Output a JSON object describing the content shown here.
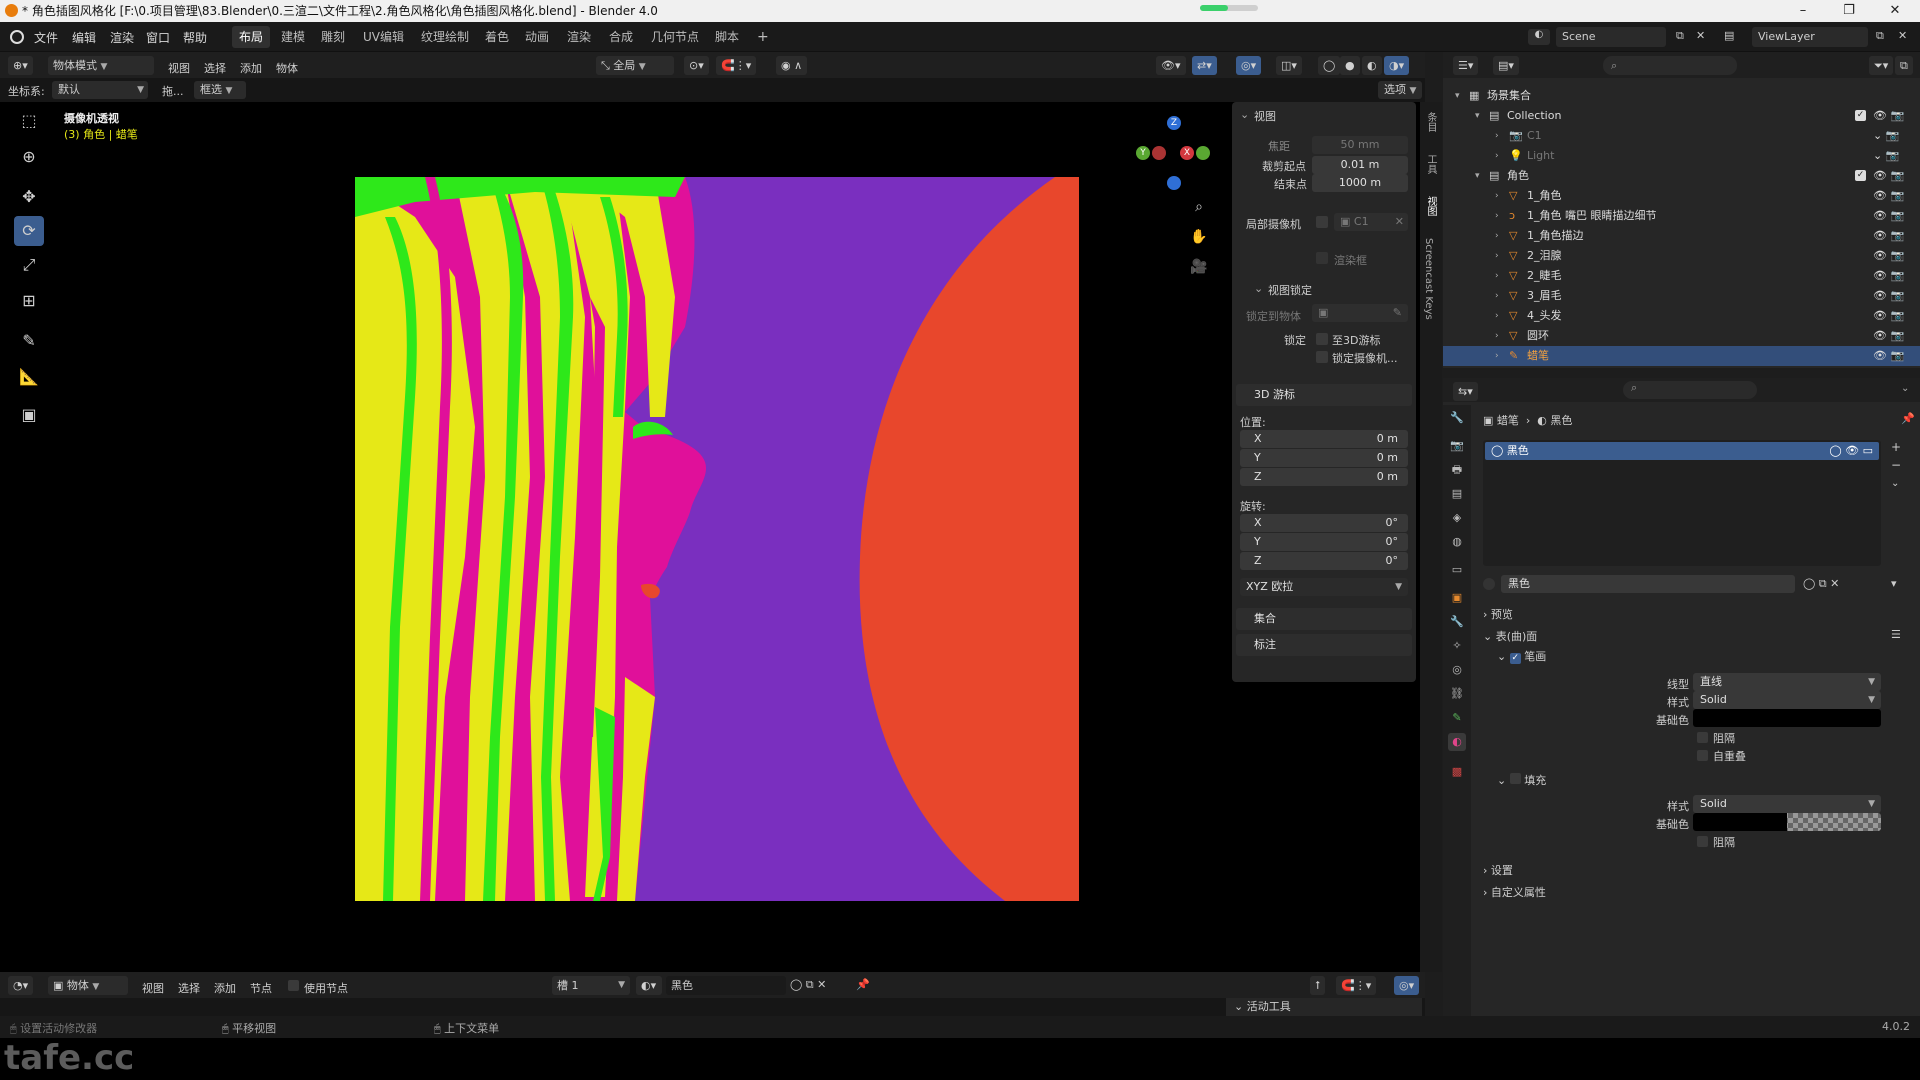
{
  "window": {
    "title": "* 角色插图风格化 [F:\\0.项目管理\\83.Blender\\0.三渲二\\文件工程\\2.角色风格化\\角色插图风格化.blend] - Blender 4.0"
  },
  "menu": {
    "items": [
      "文件",
      "编辑",
      "渲染",
      "窗口",
      "帮助"
    ]
  },
  "workspaces": [
    "布局",
    "建模",
    "雕刻",
    "UV编辑",
    "纹理绘制",
    "着色",
    "动画",
    "渲染",
    "合成",
    "几何节点",
    "脚本"
  ],
  "workspace_active": "布局",
  "scene": {
    "label": "Scene",
    "viewlayer": "ViewLayer"
  },
  "header3d": {
    "mode": "物体模式",
    "menus": [
      "视图",
      "选择",
      "添加",
      "物体"
    ],
    "orientation": "全局",
    "options": "选项"
  },
  "header2": {
    "coord_label": "坐标系:",
    "coord_value": "默认",
    "drag": "拖...",
    "select": "框选"
  },
  "viewport": {
    "title": "摄像机透视",
    "subtitle": "(3) 角色 | 蜡笔"
  },
  "npanel": {
    "view_title": "视图",
    "focal_label": "焦距",
    "focal_value": "50 mm",
    "clip_start_label": "裁剪起点",
    "clip_start_value": "0.01 m",
    "clip_end_label": "结束点",
    "clip_end_value": "1000 m",
    "local_camera_label": "局部摄像机",
    "local_camera_value": "C1",
    "render_region": "渲染框",
    "view_lock_title": "视图锁定",
    "lock_to_object_label": "锁定到物体",
    "lock_label": "锁定",
    "lock_cursor": "至3D游标",
    "lock_camera": "锁定摄像机...",
    "cursor_title": "3D 游标",
    "location_label": "位置:",
    "loc_x": "0 m",
    "loc_y": "0 m",
    "loc_z": "0 m",
    "rotation_label": "旋转:",
    "rot_x": "0°",
    "rot_y": "0°",
    "rot_z": "0°",
    "rotation_mode": "XYZ 欧拉",
    "axis_x": "X",
    "axis_y": "Y",
    "axis_z": "Z",
    "collection_section": "集合",
    "annotation_section": "标注"
  },
  "vtabs": [
    "条目",
    "工具",
    "视图",
    "Screencast Keys"
  ],
  "outliner": {
    "rows": [
      {
        "name": "场景集合",
        "depth": 0
      },
      {
        "name": "Collection",
        "depth": 1
      },
      {
        "name": "C1",
        "depth": 2,
        "dim": true
      },
      {
        "name": "Light",
        "depth": 2,
        "dim": true
      },
      {
        "name": "角色",
        "depth": 1
      },
      {
        "name": "1_角色",
        "depth": 2
      },
      {
        "name": "1_角色 嘴巴 眼睛描边细节",
        "depth": 2
      },
      {
        "name": "1_角色描边",
        "depth": 2
      },
      {
        "name": "2_泪腺",
        "depth": 2
      },
      {
        "name": "2_睫毛",
        "depth": 2
      },
      {
        "name": "3_眉毛",
        "depth": 2
      },
      {
        "name": "4_头发",
        "depth": 2
      },
      {
        "name": "圆环",
        "depth": 2
      },
      {
        "name": "蜡笔",
        "depth": 2,
        "selected": true
      }
    ]
  },
  "properties": {
    "breadcrumb_obj": "蜡笔",
    "breadcrumb_mat": "黑色",
    "slot_name": "黑色",
    "material_field": "黑色",
    "preview": "预览",
    "surface": "表(曲)面",
    "stroke": "笔画",
    "line_type_label": "线型",
    "line_type_value": "直线",
    "style_label": "样式",
    "style_value": "Solid",
    "base_color_label": "基础色",
    "holdout": "阻隔",
    "self_overlap": "自重叠",
    "fill": "填充",
    "fill_style_value": "Solid",
    "settings": "设置",
    "custom_props": "自定义属性"
  },
  "timeline": {
    "mode": "物体",
    "menus": [
      "视图",
      "选择",
      "添加",
      "节点"
    ],
    "use_nodes": "使用节点",
    "slot": "槽 1",
    "material": "黑色"
  },
  "status": {
    "left": "设置活动修改器",
    "mid": "平移视图",
    "right": "上下文菜单",
    "active_tool": "活动工具",
    "version": "4.0.2"
  },
  "watermark": "tafe.cc",
  "colors": {
    "accent": "#334e7a",
    "purple": "#7a2fbf",
    "red": "#e8472c",
    "magenta": "#e0109a",
    "yellow": "#e6e817",
    "green": "#2ee81a"
  }
}
